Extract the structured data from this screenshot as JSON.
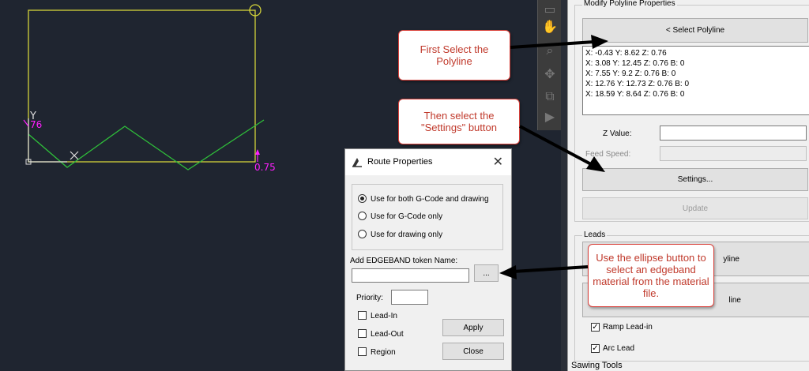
{
  "viewport": {
    "axis_y_label": "Y",
    "dim_left": "76",
    "dim_right": "0.75"
  },
  "toolbar": {
    "icons": [
      "hand-icon",
      "zoom-icon",
      "pan-icon",
      "move-icon",
      "play-icon"
    ]
  },
  "panel": {
    "section_title": "Modify Polyline Properties",
    "select_button": "< Select Polyline",
    "points": [
      "X: -0.43 Y: 8.62 Z: 0.76",
      "X: 3.08 Y: 12.45 Z: 0.76 B: 0",
      "X: 7.55 Y: 9.2 Z: 0.76 B: 0",
      "X: 12.76 Y: 12.73 Z: 0.76 B: 0",
      "X: 18.59 Y: 8.64 Z: 0.76 B: 0"
    ],
    "z_value_label": "Z Value:",
    "feed_speed_label": "Feed Speed:",
    "settings_button": "Settings...",
    "update_button": "Update",
    "leads_title": "Leads",
    "lead_button_1_tail": "yline",
    "lead_button_2_tail": "line",
    "ramp_leadin_label": "Ramp Lead-in",
    "arc_lead_label": "Arc Lead",
    "ramp_leadin_checked": true,
    "arc_lead_checked": true,
    "sawing_tools": "Sawing Tools"
  },
  "callouts": {
    "first": "First Select the Polyline",
    "second": "Then select the \"Settings\" button",
    "third": "Use the ellipse button to select an edgeband material from the material file."
  },
  "dialog": {
    "title": "Route Properties",
    "close_glyph": "✕",
    "radio_both": "Use for both G-Code and drawing",
    "radio_gcode": "Use for G-Code only",
    "radio_drawing": "Use for drawing only",
    "edgeband_label": "Add EDGEBAND token Name:",
    "edgeband_value": "",
    "ellipse_button": "...",
    "priority_label": "Priority:",
    "priority_value": "",
    "lead_in_label": "Lead-In",
    "lead_out_label": "Lead-Out",
    "region_label": "Region",
    "apply_button": "Apply",
    "close_button": "Close"
  },
  "colors": {
    "viewport_bg": "#1f2530",
    "rect_line": "#d4d43a",
    "polyline": "#2fbf3a",
    "dimension": "#ff1fff",
    "callout_border": "#d9403a",
    "callout_text": "#c0392b"
  }
}
